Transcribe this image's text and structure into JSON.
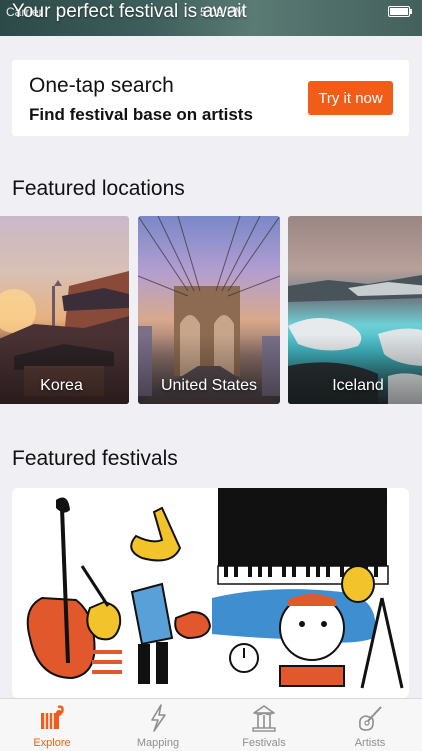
{
  "status_bar": {
    "carrier": "Carrier",
    "time": "5:09 PM",
    "tagline": "Your perfect festival is await"
  },
  "search_card": {
    "title": "One-tap search",
    "subtitle": "Find festival base on artists",
    "button_label": "Try it now"
  },
  "featured_locations": {
    "title": "Featured locations",
    "items": [
      {
        "label": "Korea"
      },
      {
        "label": "United States"
      },
      {
        "label": "Iceland"
      }
    ]
  },
  "featured_festivals": {
    "title": "Featured festivals"
  },
  "tab_bar": {
    "items": [
      {
        "label": "Explore",
        "icon": "explore-icon",
        "active": true
      },
      {
        "label": "Mapping",
        "icon": "lightning-icon",
        "active": false
      },
      {
        "label": "Festivals",
        "icon": "carousel-icon",
        "active": false
      },
      {
        "label": "Artists",
        "icon": "guitar-icon",
        "active": false
      }
    ]
  },
  "colors": {
    "accent": "#f25c19",
    "background": "#efeff4",
    "tab_inactive": "#8e8e93"
  }
}
